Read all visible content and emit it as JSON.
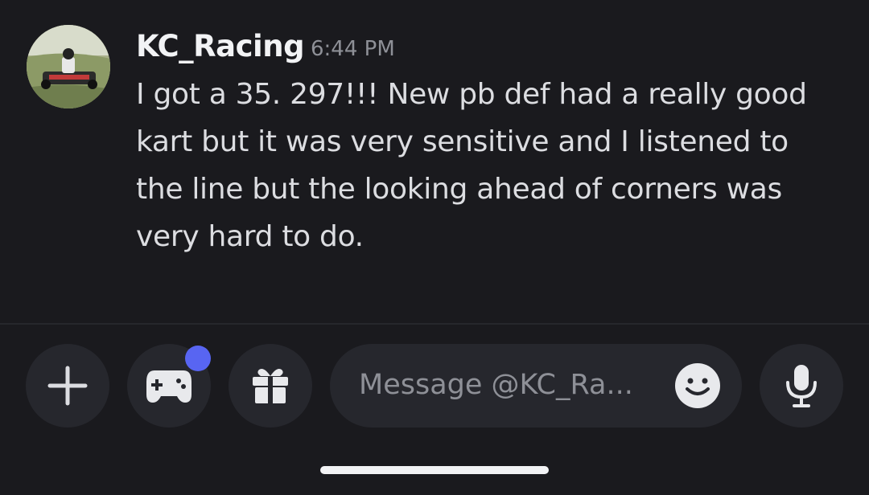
{
  "message": {
    "username": "KC_Racing",
    "timestamp": "6:44 PM",
    "text": "I got a 35. 297!!! New pb def had a really good kart but it was very sensitive and I listened to the line but the looking ahead of corners was very hard to do."
  },
  "composer": {
    "placeholder": "Message @KC_Ra...",
    "buttons": {
      "add": "plus-icon",
      "activities": "gamepad-icon",
      "gift": "gift-icon",
      "emoji": "emoji-icon",
      "voice": "microphone-icon"
    },
    "activities_notification": true
  },
  "colors": {
    "background": "#1a1a1e",
    "button_bg": "#26272d",
    "accent": "#5865f2",
    "username": "#f2f3f5",
    "timestamp": "#8e9097"
  }
}
